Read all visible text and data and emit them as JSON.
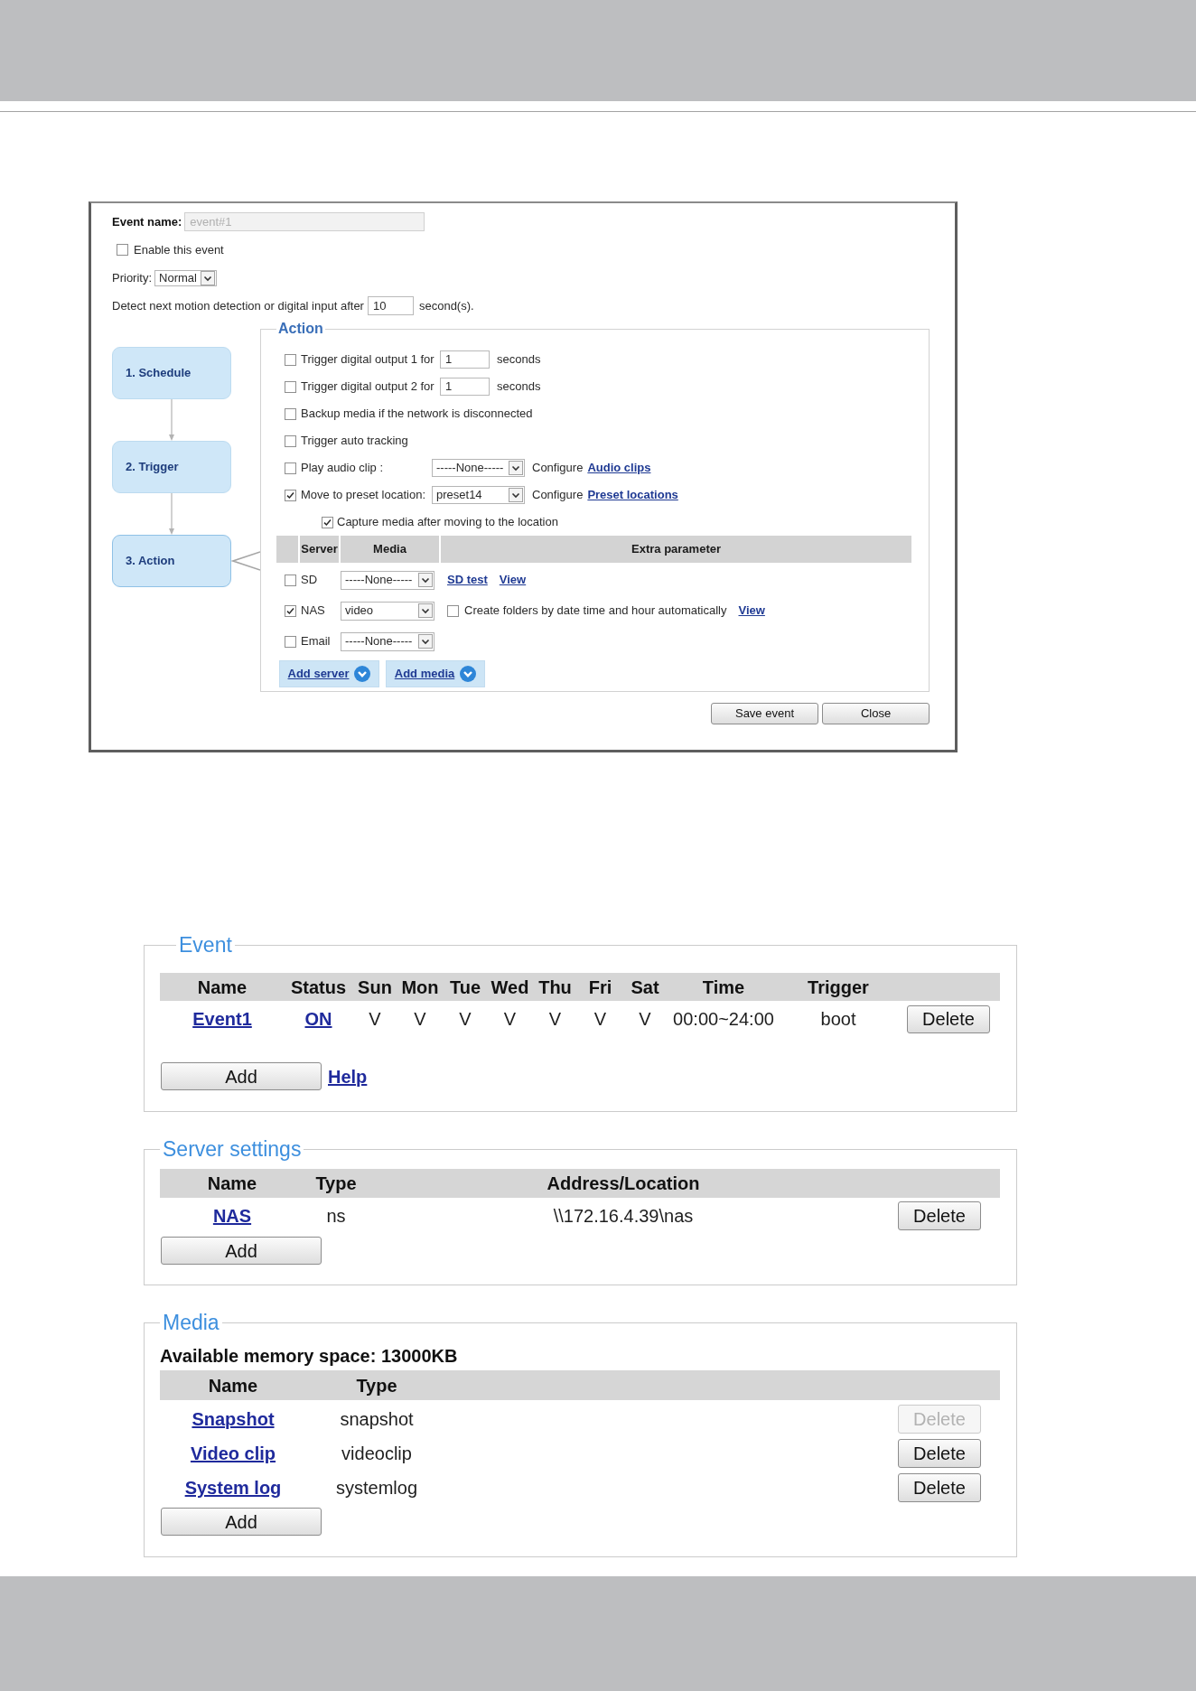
{
  "dialog": {
    "event_name": {
      "label": "Event name:",
      "value": "event#1",
      "disabled": true
    },
    "enable": {
      "label": "Enable this event",
      "checked": false
    },
    "priority": {
      "label": "Priority:",
      "value": "Normal"
    },
    "detect": {
      "label": "Detect next motion detection or digital input after",
      "value": "10",
      "unit": "second(s)."
    },
    "steps": [
      {
        "label": "1. Schedule",
        "selected": false
      },
      {
        "label": "2. Trigger",
        "selected": false
      },
      {
        "label": "3. Action",
        "selected": true
      }
    ],
    "action": {
      "legend": "Action",
      "options": [
        {
          "kind": "number",
          "label": "Trigger digital output 1 for",
          "checked": false,
          "value": "1",
          "unit": "seconds"
        },
        {
          "kind": "number",
          "label": "Trigger digital output 2 for",
          "checked": false,
          "value": "1",
          "unit": "seconds"
        },
        {
          "kind": "plain",
          "label": "Backup media if the network is disconnected",
          "checked": false
        },
        {
          "kind": "plain",
          "label": "Trigger auto tracking",
          "checked": false
        },
        {
          "kind": "select",
          "label": "Play audio clip :",
          "checked": false,
          "value": "-----None-----",
          "configure": "Configure",
          "link": "Audio clips"
        },
        {
          "kind": "select",
          "label": "Move to preset location:",
          "checked": true,
          "value": "preset14",
          "configure": "Configure",
          "link": "Preset locations"
        },
        {
          "kind": "sub",
          "label": "Capture media after moving to the location",
          "checked": true
        }
      ],
      "table": {
        "columns": [
          "Server",
          "Media",
          "Extra parameter"
        ],
        "rows": [
          {
            "checked": false,
            "server": "SD",
            "media": "-----None-----",
            "extras": [
              {
                "kind": "link",
                "text": "SD test"
              },
              {
                "kind": "link",
                "text": "View"
              }
            ]
          },
          {
            "checked": true,
            "server": "NAS",
            "media": "video",
            "extras": [
              {
                "kind": "checkbox",
                "text": "Create folders by date time and hour automatically",
                "checked": false
              },
              {
                "kind": "link",
                "text": "View"
              }
            ]
          },
          {
            "checked": false,
            "server": "Email",
            "media": "-----None-----"
          }
        ]
      },
      "add_buttons": [
        "Add server",
        "Add media"
      ]
    },
    "buttons": [
      "Save event",
      "Close"
    ]
  },
  "event": {
    "legend": "Event",
    "columns": [
      "Name",
      "Status",
      "Sun",
      "Mon",
      "Tue",
      "Wed",
      "Thu",
      "Fri",
      "Sat",
      "Time",
      "Trigger"
    ],
    "rows": [
      {
        "name": "Event1",
        "status": "ON",
        "days": [
          "V",
          "V",
          "V",
          "V",
          "V",
          "V",
          "V"
        ],
        "time": "00:00~24:00",
        "trigger": "boot",
        "delete": {
          "label": "Delete",
          "disabled": false
        }
      }
    ],
    "add": "Add",
    "help": "Help"
  },
  "server_settings": {
    "legend": "Server settings",
    "columns": [
      "Name",
      "Type",
      "Address/Location"
    ],
    "rows": [
      {
        "name": "NAS",
        "type": "ns",
        "address": "\\\\172.16.4.39\\nas",
        "delete": {
          "label": "Delete",
          "disabled": false
        }
      }
    ],
    "add": "Add"
  },
  "media": {
    "legend": "Media",
    "memory": "Available memory space: 13000KB",
    "columns": [
      "Name",
      "Type"
    ],
    "rows": [
      {
        "name": "Snapshot",
        "type": "snapshot",
        "delete": {
          "label": "Delete",
          "disabled": true
        }
      },
      {
        "name": "Video clip",
        "type": "videoclip",
        "delete": {
          "label": "Delete",
          "disabled": false
        }
      },
      {
        "name": "System log",
        "type": "systemlog",
        "delete": {
          "label": "Delete",
          "disabled": false
        }
      }
    ],
    "add": "Add"
  }
}
